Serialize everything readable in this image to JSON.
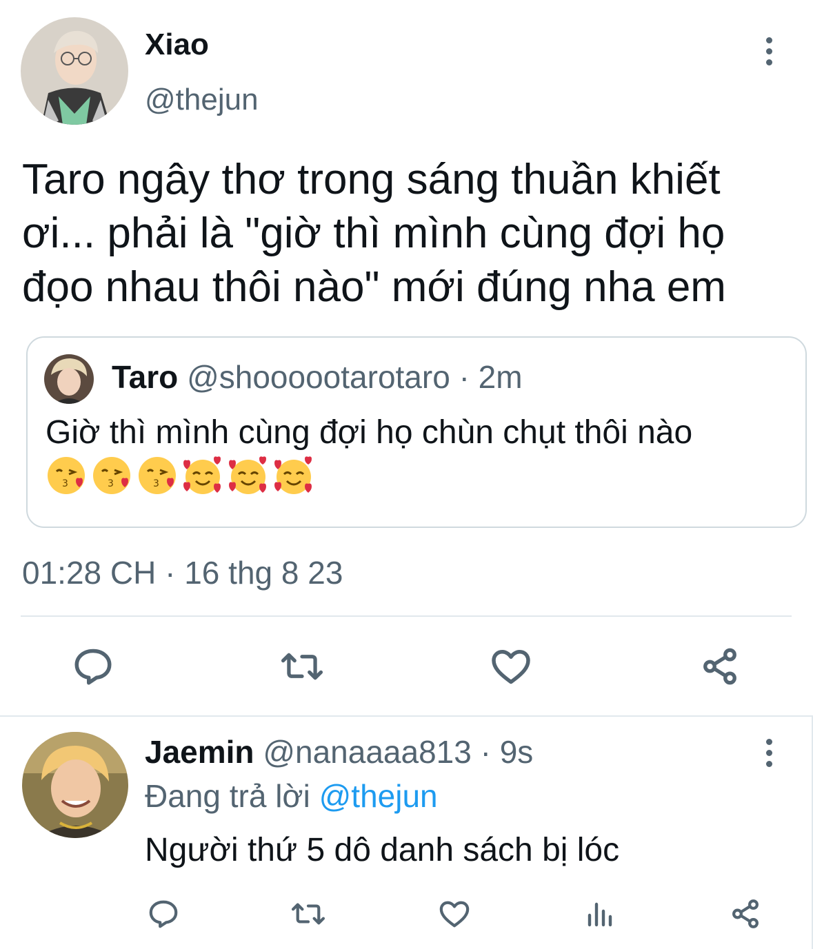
{
  "tweet": {
    "author_name": "Xiao",
    "author_handle": "@thejun",
    "text": "Taro ngây thơ trong sáng thuần khiết ơi... phải là \"giờ thì mình cùng đợi họ đọo nhau thôi nào\" mới đúng nha em",
    "timestamp": "01:28 CH · 16 thg 8 23"
  },
  "quote": {
    "author_name": "Taro",
    "author_handle": "@shoooootarotaro",
    "time_ago": " · 2m",
    "text": "Giờ thì mình cùng đợi họ chùn chụt thôi nào",
    "emojis": [
      "kissing-heart-emoji",
      "kissing-heart-emoji",
      "kissing-heart-emoji",
      "smiling-hearts-emoji",
      "smiling-hearts-emoji",
      "smiling-hearts-emoji"
    ]
  },
  "actions": [
    "reply-icon",
    "retweet-icon",
    "like-icon",
    "share-icon"
  ],
  "reply": {
    "author_name": "Jaemin",
    "author_handle": "@nanaaaa813",
    "time_ago": " · 9s",
    "replying_prefix": "Đang trả lời ",
    "replying_to": "@thejun",
    "text": "Người thứ 5 dô danh sách bị lóc",
    "actions": [
      "reply-icon",
      "retweet-icon",
      "like-icon",
      "analytics-icon",
      "share-icon"
    ]
  },
  "colors": {
    "text_primary": "#0f1419",
    "text_secondary": "#536471",
    "link": "#1d9bf0",
    "border": "#cfd9de"
  }
}
